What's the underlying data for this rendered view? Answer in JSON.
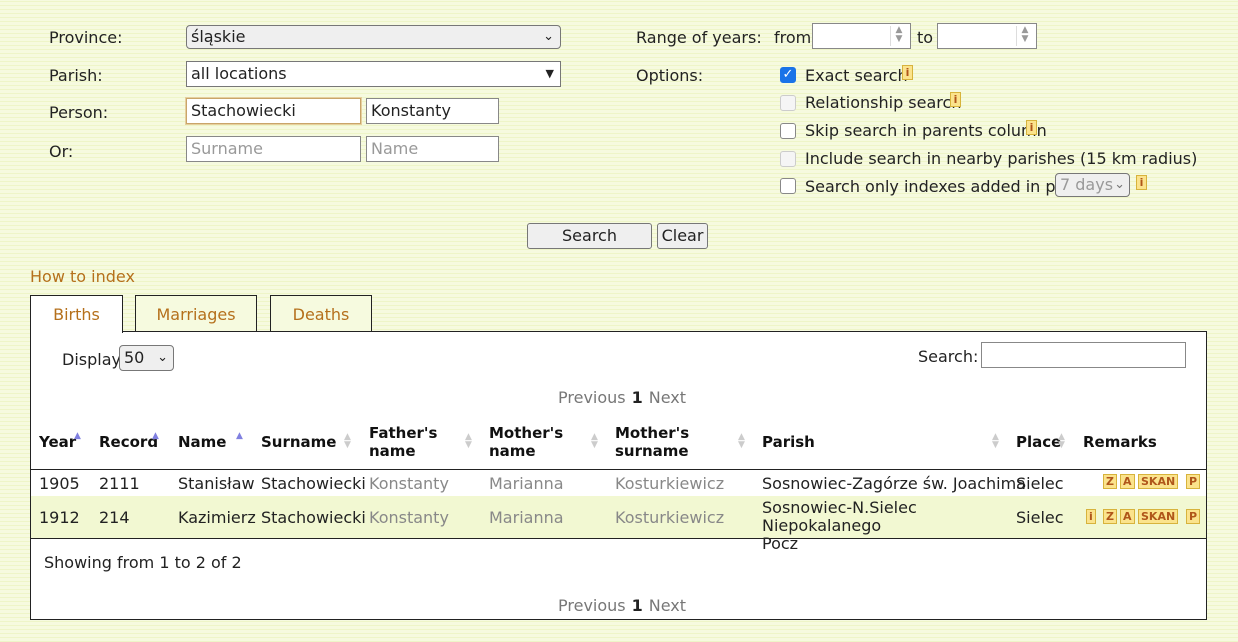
{
  "form": {
    "province_label": "Province:",
    "province_value": "śląskie",
    "parish_label": "Parish:",
    "parish_value": "all locations",
    "person_label": "Person:",
    "person_surname": "Stachowiecki",
    "person_name": "Konstanty",
    "or_label": "Or:",
    "or_surname_placeholder": "Surname",
    "or_name_placeholder": "Name",
    "range_label": "Range of years:",
    "from_label": "from",
    "to_label": "to",
    "options_label": "Options:",
    "options": [
      {
        "label": "Exact search",
        "checked": true,
        "disabled": false,
        "info": true
      },
      {
        "label": "Relationship search",
        "checked": false,
        "disabled": true,
        "info": true
      },
      {
        "label": "Skip search in parents column",
        "checked": false,
        "disabled": false,
        "info": true
      },
      {
        "label": "Include search in nearby parishes (15 km radius)",
        "checked": false,
        "disabled": true,
        "info": false
      },
      {
        "label": "Search only indexes added in past",
        "checked": false,
        "disabled": false,
        "info": true
      }
    ],
    "past_days_value": "7 days",
    "search_button": "Search",
    "clear_button": "Clear"
  },
  "how_to_index": "How to index",
  "tabs": [
    "Births",
    "Marriages",
    "Deaths"
  ],
  "results": {
    "display_label": "Display",
    "display_value": "50",
    "search_label": "Search:",
    "pager": {
      "previous": "Previous",
      "page": "1",
      "next": "Next"
    },
    "columns": [
      "Year",
      "Record",
      "Name",
      "Surname",
      "Father's name",
      "Mother's name",
      "Mother's surname",
      "Parish",
      "Place",
      "Remarks"
    ],
    "rows": [
      {
        "year": "1905",
        "record": "2111",
        "name": "Stanisław",
        "surname": "Stachowiecki",
        "father": "Konstanty",
        "mother": "Marianna",
        "mother_surname": "Kosturkiewicz",
        "parish": "Sosnowiec-Zagórze św. Joachima",
        "place": "Sielec",
        "remarks": [
          "Z",
          "A",
          "SKAN",
          "P"
        ]
      },
      {
        "year": "1912",
        "record": "214",
        "name": "Kazimierz",
        "surname": "Stachowiecki",
        "father": "Konstanty",
        "mother": "Marianna",
        "mother_surname": "Kosturkiewicz",
        "parish": "Sosnowiec-N.Sielec Niepokalanego Pocz",
        "place": "Sielec",
        "remarks": [
          "i",
          "Z",
          "A",
          "SKAN",
          "P"
        ]
      }
    ],
    "showing": "Showing from 1 to 2 of 2"
  },
  "colors": {
    "link": "#b5701c",
    "row_highlight": "#f2f8d2",
    "remark_bg": "#fbe38c"
  }
}
